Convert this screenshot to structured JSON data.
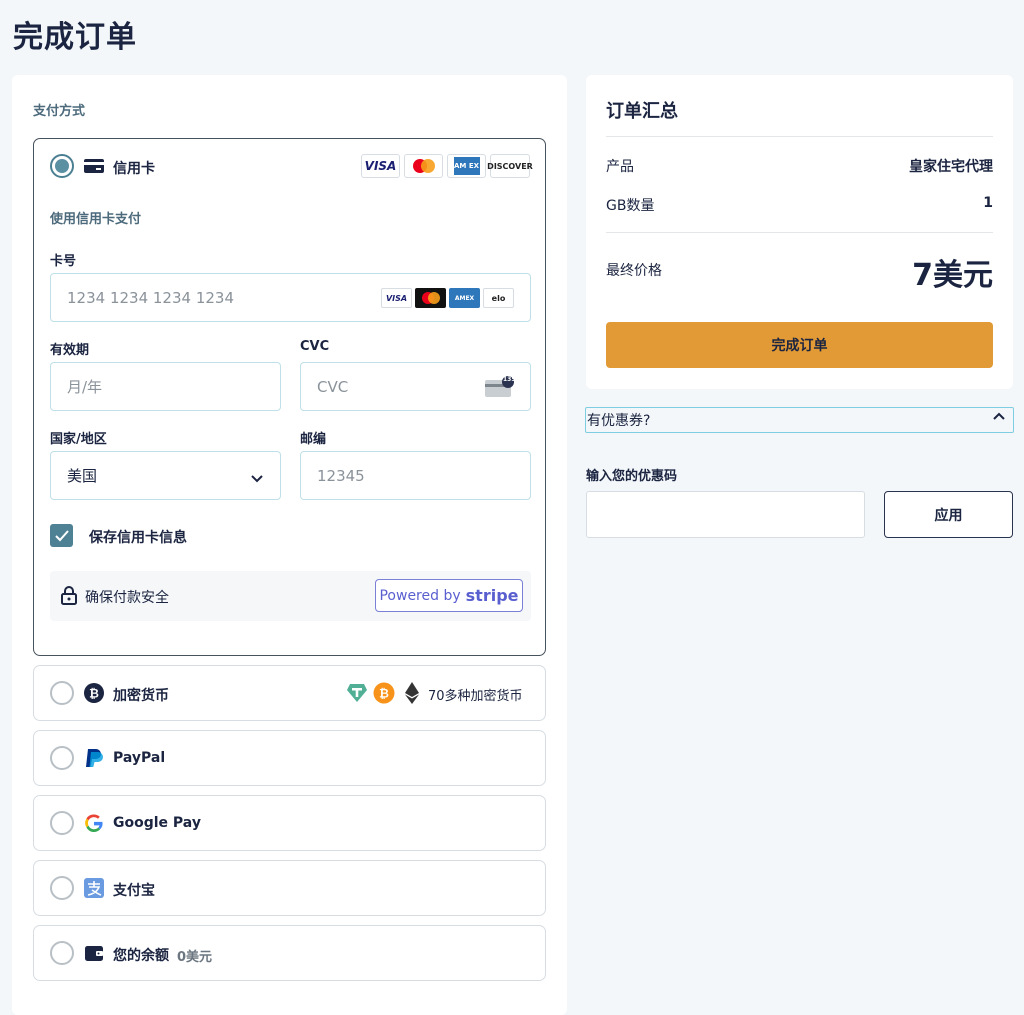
{
  "page": {
    "title": "完成订单"
  },
  "payment": {
    "section_label": "支付方式",
    "credit_card": {
      "label": "信用卡",
      "subtitle": "使用信用卡支付",
      "brands": [
        "VISA",
        "Mastercard",
        "AMEX",
        "DISCOVER"
      ],
      "card_number": {
        "label": "卡号",
        "placeholder": "1234 1234 1234 1234",
        "brands": [
          "VISA",
          "Mastercard",
          "AMEX",
          "elo"
        ]
      },
      "expiry": {
        "label": "有效期",
        "placeholder": "月/年"
      },
      "cvc": {
        "label": "CVC",
        "placeholder": "CVC",
        "badge": "135"
      },
      "country": {
        "label": "国家/地区",
        "value": "美国"
      },
      "postal": {
        "label": "邮编",
        "placeholder": "12345"
      },
      "save_card": {
        "label": "保存信用卡信息",
        "checked": true
      },
      "secure_text": "确保付款安全",
      "powered_by": "Powered by",
      "stripe": "stripe"
    },
    "crypto": {
      "label": "加密货币",
      "extra": "70多种加密货币"
    },
    "paypal": {
      "label": "PayPal"
    },
    "googlepay": {
      "label": "Google Pay"
    },
    "alipay": {
      "label": "支付宝"
    },
    "balance": {
      "label": "您的余额",
      "amount": "0美元"
    }
  },
  "summary": {
    "title": "订单汇总",
    "product_label": "产品",
    "product_value": "皇家住宅代理",
    "gb_label": "GB数量",
    "gb_value": "1",
    "final_label": "最终价格",
    "final_value": "7美元",
    "complete_button": "完成订单"
  },
  "coupon": {
    "toggle_label": "有优惠券?",
    "input_label": "输入您的优惠码",
    "apply_button": "应用"
  },
  "colors": {
    "accent": "#e19a35",
    "primary": "#1b2440",
    "teal": "#4f8194"
  }
}
